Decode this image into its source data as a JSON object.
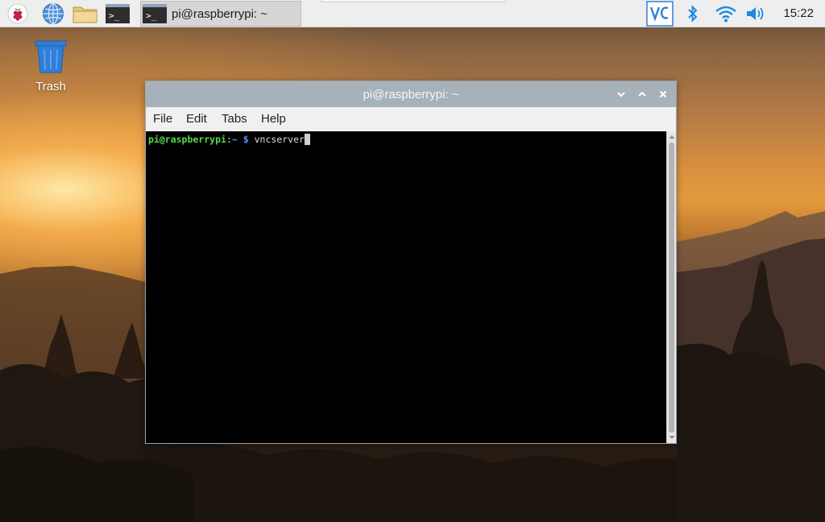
{
  "taskbar": {
    "menu_icon": "raspberry-pi-icon",
    "browser_icon": "globe-icon",
    "files_icon": "folder-icon",
    "terminal_icon": "terminal-icon",
    "active_task_label": "pi@raspberrypi: ~",
    "tray": {
      "vnc_icon": "vnc-icon",
      "bluetooth_icon": "bluetooth-icon",
      "wifi_icon": "wifi-icon",
      "volume_icon": "volume-icon",
      "clock": "15:22"
    },
    "terminal_glyph": ">_"
  },
  "desktop": {
    "trash_label": "Trash"
  },
  "window": {
    "title": "pi@raspberrypi: ~",
    "menu": [
      "File",
      "Edit",
      "Tabs",
      "Help"
    ],
    "prompt_user": "pi@raspberrypi",
    "prompt_sep": ":",
    "prompt_path": "~",
    "prompt_dollar": "$",
    "command": "vncserver"
  },
  "colors": {
    "titlebar": "#a7b1ba",
    "prompt_user": "#55d94f",
    "prompt_path": "#5c8dff",
    "vnc_accent": "#2e7fd9",
    "tray_accent": "#1f8ae0"
  }
}
